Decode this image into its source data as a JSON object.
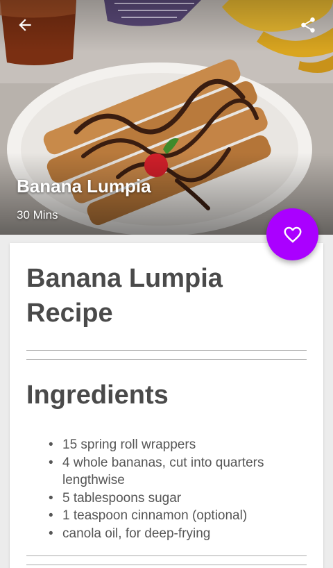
{
  "hero": {
    "title": "Banana Lumpia",
    "time": "30 Mins",
    "back_icon": "arrow-left-icon",
    "share_icon": "share-icon",
    "favorite_icon": "heart-outline-icon",
    "favorite_color": "#aa00ff"
  },
  "card": {
    "recipe_title": "Banana Lumpia Recipe",
    "section_title": "Ingredients",
    "bullet": "•",
    "ingredients": [
      "15 spring roll wrappers",
      "4 whole bananas, cut into quarters lengthwise",
      "5 tablespoons sugar",
      "1 teaspoon cinnamon (optional)",
      "canola oil, for deep-frying"
    ]
  }
}
